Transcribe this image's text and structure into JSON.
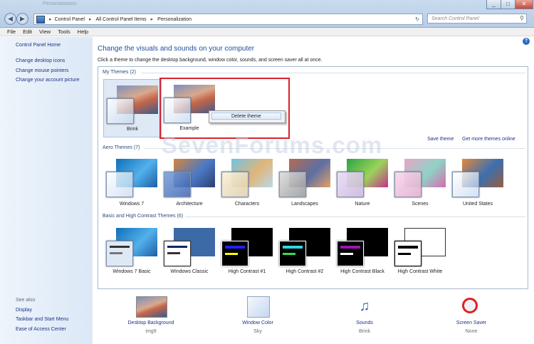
{
  "window": {
    "title": "Personalization",
    "controls": [
      "_",
      "□",
      "✕"
    ]
  },
  "address": {
    "crumbs": [
      "Control Panel",
      "All Control Panel Items",
      "Personalization"
    ],
    "search_placeholder": "Search Control Panel"
  },
  "menu": [
    "File",
    "Edit",
    "View",
    "Tools",
    "Help"
  ],
  "sidebar": {
    "home": "Control Panel Home",
    "links": [
      "Change desktop icons",
      "Change mouse pointers",
      "Change your account picture"
    ],
    "see_also_title": "See also",
    "see_also": [
      "Display",
      "Taskbar and Start Menu",
      "Ease of Access Center"
    ]
  },
  "main": {
    "title": "Change the visuals and sounds on your computer",
    "subtitle": "Click a theme to change the desktop background, window color, sounds, and screen saver all at once.",
    "my_themes_header": "My Themes (2)",
    "my_themes": [
      "Brink",
      "Example"
    ],
    "context_menu_item": "Delete theme",
    "save_theme": "Save theme",
    "get_more": "Get more themes online",
    "aero_header": "Aero Themes (7)",
    "aero_themes": [
      "Windows 7",
      "Architecture",
      "Characters",
      "Landscapes",
      "Nature",
      "Scenes",
      "United States"
    ],
    "basic_header": "Basic and High Contrast Themes (6)",
    "basic_themes": [
      "Windows 7 Basic",
      "Windows Classic",
      "High Contrast #1",
      "High Contrast #2",
      "High Contrast Black",
      "High Contrast White"
    ]
  },
  "bottom": [
    {
      "label": "Desktop Background",
      "value": "img9"
    },
    {
      "label": "Window Color",
      "value": "Sky"
    },
    {
      "label": "Sounds",
      "value": "Brink"
    },
    {
      "label": "Screen Saver",
      "value": "None"
    }
  ],
  "watermark": "SevenForums.com",
  "icons": {
    "back": "back-arrow-icon",
    "forward": "forward-arrow-icon",
    "search": "search-icon"
  }
}
